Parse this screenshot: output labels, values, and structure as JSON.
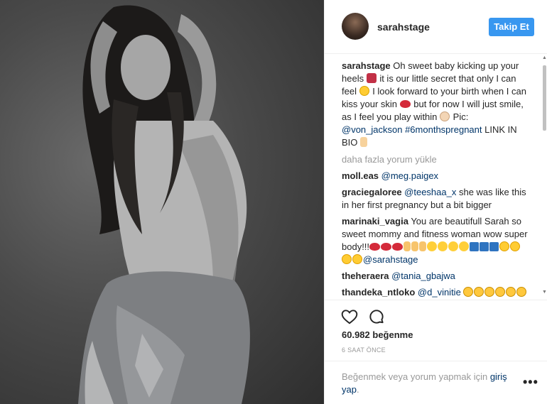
{
  "post": {
    "username": "sarahstage",
    "follow_label": "Takip Et",
    "likes": "60.982 beğenme",
    "time": "6 SAAT ÖNCE"
  },
  "caption": {
    "user": "sarahstage",
    "text1": " Oh sweet baby kicking up your heels ",
    "text2": " it is our little secret that only I can feel ",
    "text3": " I look forward to your birth when I can kiss your skin ",
    "text4": " but for now I will just smile, as I feel you play within ",
    "text5": " Pic: ",
    "mention": "@von_jackson",
    "hashtag": " #6monthspregnant",
    "text6": " LINK IN BIO "
  },
  "load_more": "daha fazla yorum yükle",
  "comments": [
    {
      "user": "moll.eas",
      "mention": " @meg.paigex",
      "text": ""
    },
    {
      "user": "graciegaloree",
      "mention": " @teeshaa_x",
      "text": " she was like this in her first pregnancy but a bit bigger"
    },
    {
      "user": "marinaki_vagia",
      "mention": "",
      "text": " You are beautifull Sarah so sweet mommy and fitness woman wow super body!!!",
      "mention2": "@sarahstage"
    },
    {
      "user": "theheraera",
      "mention": " @tania_gbajwa",
      "text": ""
    },
    {
      "user": "thandeka_ntloko",
      "mention": " @d_vinitie",
      "text": " "
    }
  ],
  "footer": {
    "text": "Beğenmek veya yorum yapmak için ",
    "login": "giriş yap",
    "tail": ".",
    "more": "•••"
  },
  "colors": {
    "accent": "#3897f0",
    "link": "#003569",
    "muted": "#999999"
  },
  "icons": [
    "heart-icon",
    "comment-icon",
    "more-options-icon"
  ]
}
